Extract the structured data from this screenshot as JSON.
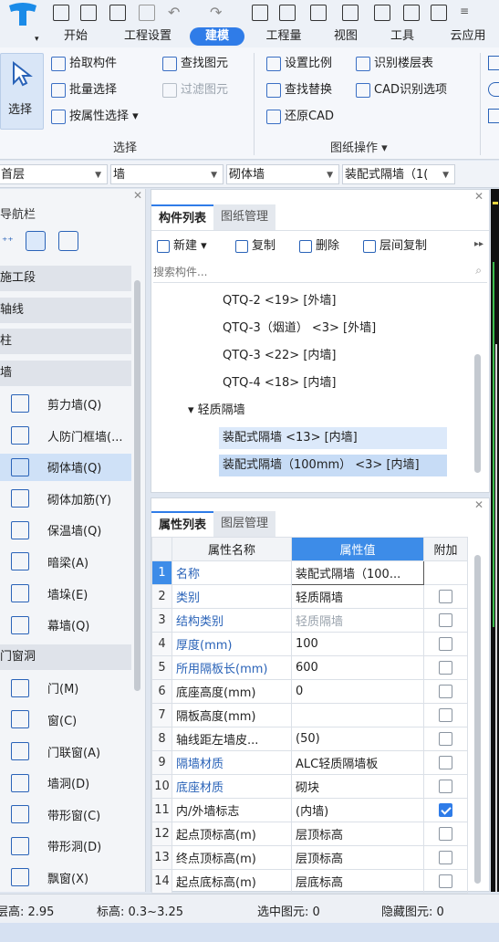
{
  "menu": {
    "tabs": [
      "开始",
      "工程设置",
      "建模",
      "工程量",
      "视图",
      "工具",
      "云应用"
    ],
    "active": "建模"
  },
  "ribbon": {
    "select_label": "选择",
    "select_group": [
      {
        "label": "拾取构件",
        "icon": "pick-icon"
      },
      {
        "label": "批量选择",
        "icon": "batch-select-icon"
      },
      {
        "label": "按属性选择 ▾",
        "icon": "attr-select-icon"
      }
    ],
    "find_group": [
      {
        "label": "查找图元",
        "icon": "find-icon"
      },
      {
        "label": "过滤图元",
        "icon": "filter-icon",
        "disabled": true
      }
    ],
    "drawing_group": [
      {
        "label": "设置比例",
        "icon": "scale-icon"
      },
      {
        "label": "识别楼层表",
        "icon": "floor-table-icon"
      },
      {
        "label": "查找替换",
        "icon": "replace-icon"
      },
      {
        "label": "CAD识别选项",
        "icon": "cad-options-icon"
      },
      {
        "label": "还原CAD",
        "icon": "restore-cad-icon"
      }
    ],
    "group_select": "选择",
    "group_drawing": "图纸操作 ▾"
  },
  "dropdowns": [
    "首层",
    "墙",
    "砌体墙",
    "装配式隔墙（1("
  ],
  "nav": {
    "title": "导航栏",
    "items": [
      {
        "type": "cat",
        "label": "施工段"
      },
      {
        "type": "cat",
        "label": "轴线"
      },
      {
        "type": "cat",
        "label": "柱"
      },
      {
        "type": "cat",
        "label": "墙"
      },
      {
        "type": "item",
        "label": "剪力墙(Q)"
      },
      {
        "type": "item",
        "label": "人防门框墙(..."
      },
      {
        "type": "item",
        "label": "砌体墙(Q)",
        "selected": true
      },
      {
        "type": "item",
        "label": "砌体加筋(Y)"
      },
      {
        "type": "item",
        "label": "保温墙(Q)"
      },
      {
        "type": "item",
        "label": "暗梁(A)"
      },
      {
        "type": "item",
        "label": "墙垛(E)"
      },
      {
        "type": "item",
        "label": "幕墙(Q)"
      },
      {
        "type": "cat",
        "label": "门窗洞"
      },
      {
        "type": "item",
        "label": "门(M)"
      },
      {
        "type": "item",
        "label": "窗(C)"
      },
      {
        "type": "item",
        "label": "门联窗(A)"
      },
      {
        "type": "item",
        "label": "墙洞(D)"
      },
      {
        "type": "item",
        "label": "带形窗(C)"
      },
      {
        "type": "item",
        "label": "带形洞(D)"
      },
      {
        "type": "item",
        "label": "飘窗(X)"
      }
    ]
  },
  "component_list": {
    "tabs": [
      "构件列表",
      "图纸管理"
    ],
    "toolbar": [
      "新建 ▾",
      "复制",
      "删除",
      "层间复制"
    ],
    "search_placeholder": "搜索构件...",
    "tree": [
      {
        "label": "QTQ-2 <19> [外墙]"
      },
      {
        "label": "QTQ-3（烟道） <3> [外墙]"
      },
      {
        "label": "QTQ-3 <22> [内墙]"
      },
      {
        "label": "QTQ-4 <18> [内墙]"
      },
      {
        "label": "▾ 轻质隔墙",
        "group": true
      },
      {
        "label": "装配式隔墙 <13> [内墙]",
        "sel": 1
      },
      {
        "label": "装配式隔墙（100mm） <3> [内墙]",
        "sel": 2
      }
    ]
  },
  "properties": {
    "tabs": [
      "属性列表",
      "图层管理"
    ],
    "headers": [
      "属性名称",
      "属性值",
      "附加"
    ],
    "rows": [
      {
        "n": "1",
        "name": "名称",
        "value": "装配式隔墙（100...",
        "blue": true,
        "check": null
      },
      {
        "n": "2",
        "name": "类别",
        "value": "轻质隔墙",
        "blue": true,
        "check": false
      },
      {
        "n": "3",
        "name": "结构类别",
        "value": "轻质隔墙",
        "blue": true,
        "grey": true,
        "check": false
      },
      {
        "n": "4",
        "name": "厚度(mm)",
        "value": "100",
        "blue": true,
        "check": false
      },
      {
        "n": "5",
        "name": "所用隔板长(mm)",
        "value": "600",
        "blue": true,
        "check": false
      },
      {
        "n": "6",
        "name": "底座高度(mm)",
        "value": "0",
        "blue": false,
        "check": false
      },
      {
        "n": "7",
        "name": "隔板高度(mm)",
        "value": "",
        "blue": false,
        "check": false
      },
      {
        "n": "8",
        "name": "轴线距左墙皮...",
        "value": "(50)",
        "blue": false,
        "check": false
      },
      {
        "n": "9",
        "name": "隔墙材质",
        "value": "ALC轻质隔墙板",
        "blue": true,
        "check": false
      },
      {
        "n": "10",
        "name": "底座材质",
        "value": "砌块",
        "blue": true,
        "check": false
      },
      {
        "n": "11",
        "name": "内/外墙标志",
        "value": "(内墙)",
        "blue": false,
        "check": true
      },
      {
        "n": "12",
        "name": "起点顶标高(m)",
        "value": "层顶标高",
        "blue": false,
        "check": false
      },
      {
        "n": "13",
        "name": "终点顶标高(m)",
        "value": "层顶标高",
        "blue": false,
        "check": false
      },
      {
        "n": "14",
        "name": "起点底标高(m)",
        "value": "层底标高",
        "blue": false,
        "check": false
      }
    ]
  },
  "status": {
    "floor_height": "层高:  2.95",
    "elevation": "标高:  0.3~3.25",
    "selected": "选中图元:  0",
    "hidden": "隐藏图元:  0"
  },
  "colors": {
    "accent": "#2f7ce8",
    "icon": "#2a63b8"
  }
}
